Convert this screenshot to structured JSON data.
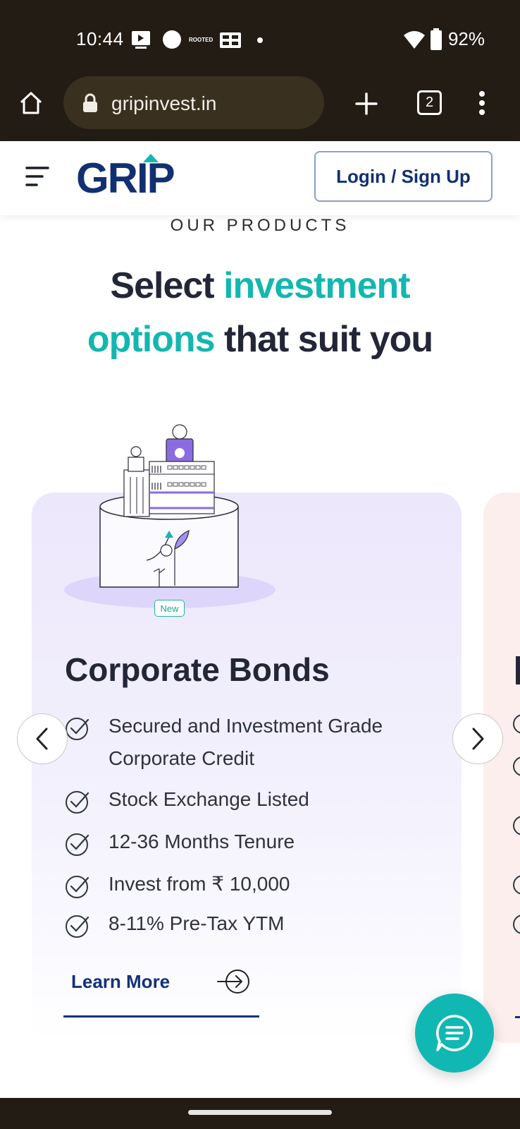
{
  "status_bar": {
    "time": "10:44",
    "rooted_label": "ROOTED",
    "battery": "92%",
    "icons": [
      "screen-cast-icon",
      "circle-icon",
      "rooted-badge-icon",
      "grid-app-icon",
      "dot-icon",
      "wifi-icon",
      "battery-icon"
    ]
  },
  "browser": {
    "url": "gripinvest.in",
    "tab_count": "2",
    "icons": [
      "home-icon",
      "lock-icon",
      "plus-icon",
      "tabs-icon",
      "more-vert-icon"
    ]
  },
  "header": {
    "logo_text": "GRIP",
    "login_label": "Login / Sign Up"
  },
  "section": {
    "eyebrow": "OUR PRODUCTS",
    "headline_1": "Select ",
    "headline_accent_1": "investment",
    "headline_accent_2": "options",
    "headline_2": " that suit you"
  },
  "card": {
    "badge": "New",
    "title": "Corporate Bonds",
    "features": [
      "Secured and Investment Grade Corporate Credit",
      "Stock Exchange Listed",
      "12-36 Months Tenure",
      "Invest from ₹ 10,000",
      "8-11% Pre-Tax YTM"
    ],
    "cta": "Learn More"
  },
  "colors": {
    "brand_navy": "#123071",
    "accent_teal": "#13b7b0",
    "card_lavender": "#ece7fb",
    "system_bar": "#221c14"
  }
}
